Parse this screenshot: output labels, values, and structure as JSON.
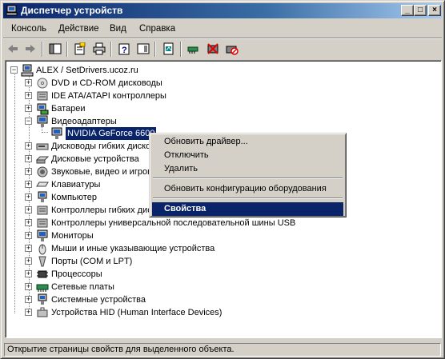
{
  "window": {
    "title": "Диспетчер устройств"
  },
  "title_buttons": {
    "minimize": "_",
    "maximize": "□",
    "close": "×"
  },
  "menu": [
    "Консоль",
    "Действие",
    "Вид",
    "Справка"
  ],
  "toolbar": {
    "icons": [
      "back-arrow-icon",
      "forward-arrow-icon",
      "show-hide-tree-icon",
      "properties-icon",
      "print-icon",
      "help-icon",
      "console-tree-icon",
      "update-driver-icon",
      "scan-hardware-icon",
      "uninstall-icon",
      "disable-icon"
    ]
  },
  "tree": {
    "root": "ALEX / SetDrivers.ucoz.ru",
    "categories": [
      "DVD и CD-ROM дисководы",
      "IDE ATA/ATAPI контроллеры",
      "Батареи",
      "Видеоадаптеры",
      "NVIDIA GeForce 6600",
      "Дисководы гибких дисков",
      "Дисковые устройства",
      "Звуковые, видео и игровые устройства",
      "Клавиатуры",
      "Компьютер",
      "Контроллеры гибких дисков",
      "Контроллеры универсальной последовательной шины USB",
      "Мониторы",
      "Мыши и иные указывающие устройства",
      "Порты (COM и LPT)",
      "Процессоры",
      "Сетевые платы",
      "Системные устройства",
      "Устройства HID (Human Interface Devices)"
    ]
  },
  "context_menu": {
    "update_driver": "Обновить драйвер...",
    "disable": "Отключить",
    "delete": "Удалить",
    "scan": "Обновить конфигурацию оборудования",
    "properties": "Свойства"
  },
  "status": "Открытие страницы свойств для выделенного объекта.",
  "colors": {
    "title_start": "#0a246a",
    "title_end": "#a6caf0",
    "selection": "#0a246a",
    "face": "#d4d0c8"
  }
}
